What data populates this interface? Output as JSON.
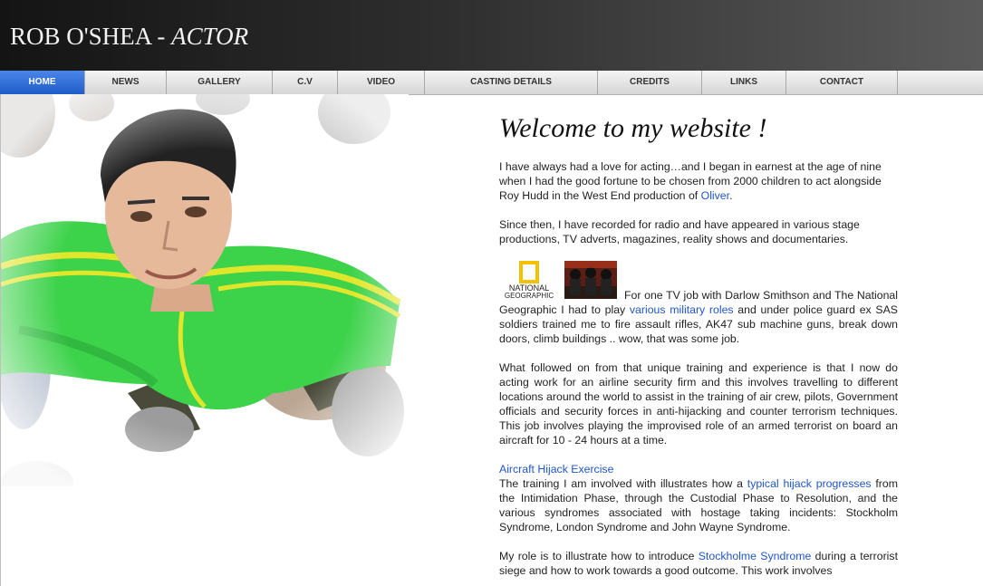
{
  "header": {
    "title_name": "ROB O'SHEA - ",
    "title_role": "ACTOR"
  },
  "nav": {
    "items": [
      "HOME",
      "NEWS",
      "GALLERY",
      "C.V",
      "VIDEO",
      "CASTING DETAILS",
      "CREDITS",
      "LINKS",
      "CONTACT"
    ],
    "active": "HOME"
  },
  "content": {
    "welcome": "Welcome to my website !",
    "p1_text": "I have always had a love for acting…and I began in earnest at the age of nine when I had the good fortune to be chosen from 2000 children to act alongside Roy Hudd in the West End production of ",
    "p1_link": "Oliver",
    "p1_end": ".",
    "p2": "Since then, I have recorded for radio and have appeared in various stage productions, TV adverts, magazines, reality shows and documentaries.",
    "ng_logo_line1": "NATIONAL",
    "ng_logo_line2": "GEOGRAPHIC",
    "p3_start": "For one TV job with Darlow Smithson and The National Geographic I had to play ",
    "p3_link": "various military roles",
    "p3_end": " and under police guard ex SAS soldiers trained me to fire assault rifles, AK47 sub machine guns, break down doors, climb buildings .. wow, that was some job.",
    "p4": "What followed on from that unique training and experience is that I now do acting work for an airline security firm and this involves travelling to different locations around the world to assist in the training of air crew, pilots, Government officials and security forces in anti-hijacking and counter terrorism techniques. This job involves playing the improvised role of an armed terrorist on board an aircraft for 10 - 24 hours at a time.",
    "aircraft_link": "Aircraft Hijack Exercise",
    "p5_start": "The training I am involved with illustrates how a ",
    "p5_link": "typical hijack progresses",
    "p5_end": " from the Intimidation Phase, through the Custodial Phase to Resolution, and the various syndromes associated with hostage taking incidents: Stockholm Syndrome, London Syndrome and John Wayne Syndrome.",
    "p6_start": "My role is to illustrate how to introduce ",
    "p6_link": "Stockholme Syndrome",
    "p6_end": " during a terrorist siege and how to work towards a good outcome. This work involves"
  },
  "colors": {
    "link": "#1f56c9",
    "nav_active": "#1f5cc9",
    "shirt": "#3cd24a",
    "stripe": "#e2e62a"
  },
  "icons": [
    "national-geographic-logo",
    "soldiers-thumbnail",
    "actor-portrait"
  ]
}
